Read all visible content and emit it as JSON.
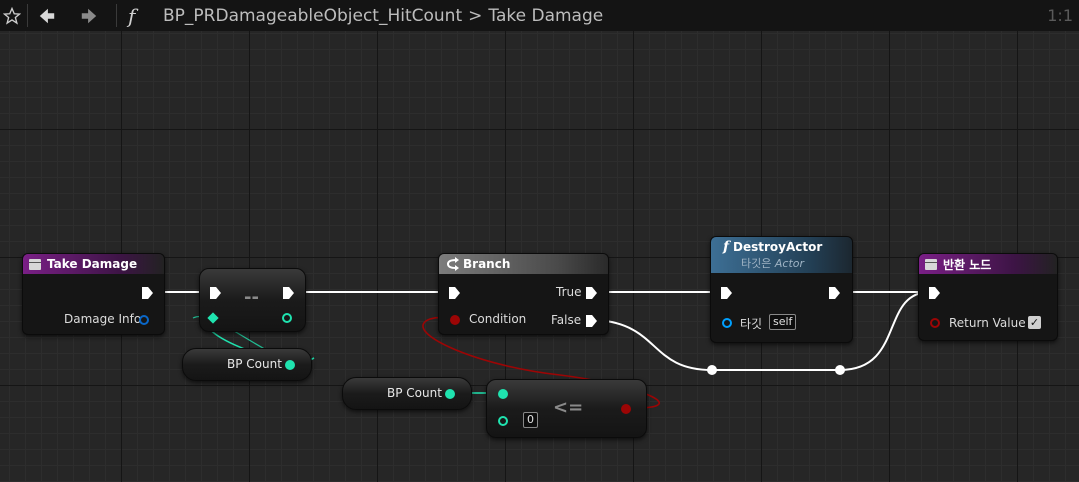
{
  "toolbar": {
    "favorite_icon": "star-icon",
    "back_icon": "back-arrow-icon",
    "forward_icon": "forward-arrow-icon",
    "function_glyph": "f",
    "blueprint_name": "BP_PRDamageableObject_HitCount",
    "crumb_separator": ">",
    "function_name": "Take Damage",
    "zoom": "1:1"
  },
  "nodes": {
    "take_damage": {
      "title": "Take Damage",
      "pin_damage_info": "Damage Info"
    },
    "decrement": {
      "op": "--"
    },
    "bp_count_get_1": {
      "label": "BP Count"
    },
    "branch": {
      "title": "Branch",
      "pin_true": "True",
      "pin_false": "False",
      "pin_condition": "Condition"
    },
    "destroy_actor": {
      "title": "DestroyActor",
      "subtitle_prefix": "타깃은",
      "subtitle_type": "Actor",
      "pin_target": "타깃",
      "target_value": "self"
    },
    "return_node": {
      "title": "반환 노드",
      "pin_return": "Return Value",
      "return_checked": "✓"
    },
    "bp_count_get_2": {
      "label": "BP Count"
    },
    "compare": {
      "op": "<=",
      "b_value": "0"
    }
  },
  "colors": {
    "exec": "#ffffff",
    "integer": "#1fe3af",
    "boolean": "#9c0505",
    "struct": "#0a67c8"
  }
}
